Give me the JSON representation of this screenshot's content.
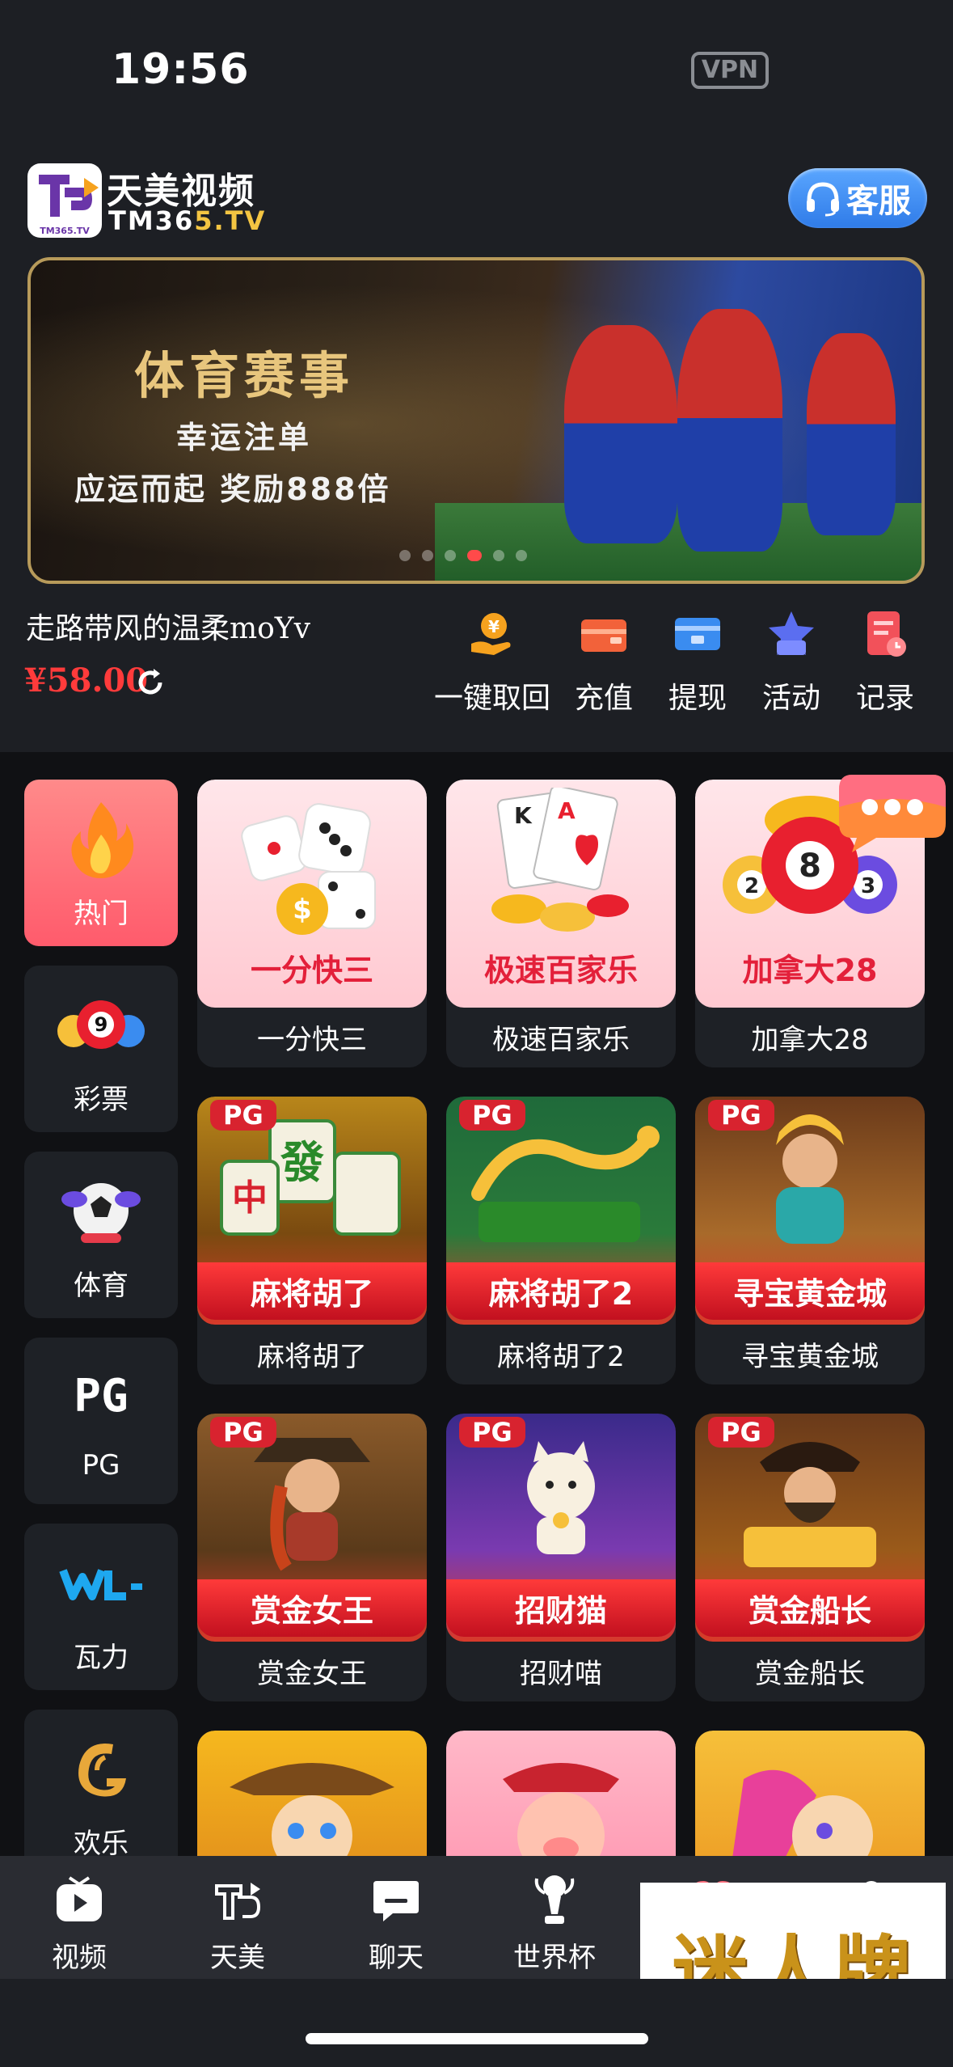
{
  "status": {
    "time": "19:56",
    "vpn": "VPN"
  },
  "header": {
    "logo_badge": "TM365.TV",
    "title": "天美视频",
    "subtitle_main": "TM36",
    "subtitle_accent": "5.TV",
    "service_label": "客服"
  },
  "banner": {
    "headline": "体育赛事",
    "line2": "幸运注单",
    "line3": "应运而起 奖励888倍",
    "slide_count": 6,
    "active_slide": 4
  },
  "user": {
    "name": "走路带风的温柔moYv",
    "balance": "¥58.00"
  },
  "actions": [
    {
      "label": "一键取回",
      "icon": "coin-hand-icon"
    },
    {
      "label": "充值",
      "icon": "wallet-icon"
    },
    {
      "label": "提现",
      "icon": "withdraw-card-icon"
    },
    {
      "label": "活动",
      "icon": "star-gift-icon"
    },
    {
      "label": "记录",
      "icon": "record-doc-icon"
    }
  ],
  "sidebar": [
    {
      "label": "热门",
      "icon": "flame-icon",
      "active": true
    },
    {
      "label": "彩票",
      "icon": "lottery-ball-icon"
    },
    {
      "label": "体育",
      "icon": "soccer-mascot-icon"
    },
    {
      "label": "PG",
      "icon": "pg-logo-icon"
    },
    {
      "label": "瓦力",
      "icon": "wali-logo-icon"
    },
    {
      "label": "欢乐",
      "icon": "huanle-logo-icon"
    }
  ],
  "games": [
    {
      "name": "一分快三",
      "art_title": "一分快三",
      "style": "pink"
    },
    {
      "name": "极速百家乐",
      "art_title": "极速百家乐",
      "style": "pink"
    },
    {
      "name": "加拿大28",
      "art_title": "加拿大28",
      "style": "pink"
    },
    {
      "name": "麻将胡了",
      "art_title": "麻将胡了",
      "style": "pg",
      "tag": "PG"
    },
    {
      "name": "麻将胡了2",
      "art_title": "麻将胡了2",
      "style": "pg",
      "tag": "PG"
    },
    {
      "name": "寻宝黄金城",
      "art_title": "寻宝黄金城",
      "style": "pg",
      "tag": "PG"
    },
    {
      "name": "赏金女王",
      "art_title": "赏金女王",
      "style": "pg",
      "tag": "PG"
    },
    {
      "name": "招财喵",
      "art_title": "招财猫",
      "style": "pg",
      "tag": "PG"
    },
    {
      "name": "赏金船长",
      "art_title": "赏金船长",
      "style": "pg",
      "tag": "PG"
    }
  ],
  "tabs": [
    {
      "label": "视频",
      "icon": "play-tv-icon"
    },
    {
      "label": "天美",
      "icon": "tianmei-logo-icon"
    },
    {
      "label": "聊天",
      "icon": "chat-icon"
    },
    {
      "label": "世界杯",
      "icon": "trophy-icon"
    }
  ],
  "promo": {
    "text": "迷人牌"
  },
  "colors": {
    "accent_red": "#ff3b3b",
    "service_blue": "#3a8cf0",
    "banner_gold": "#e8c67d"
  }
}
